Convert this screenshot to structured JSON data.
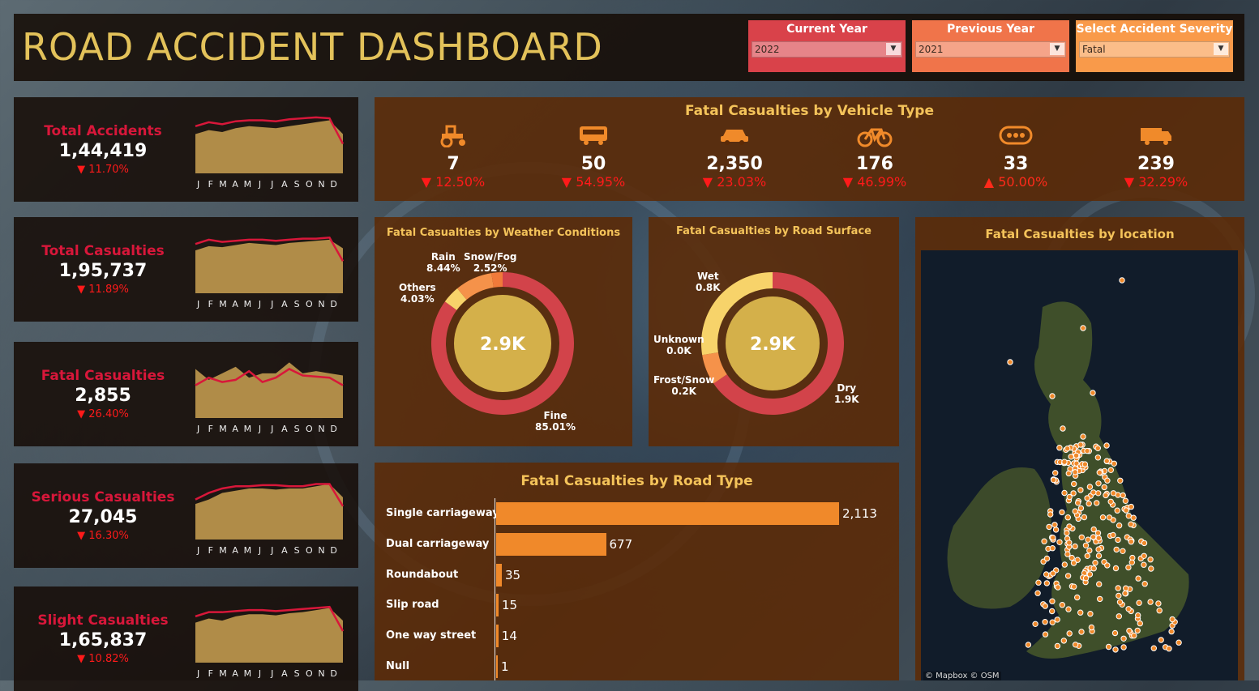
{
  "header": {
    "title": "ROAD ACCIDENT DASHBOARD",
    "filters": [
      {
        "label": "Current Year",
        "value": "2022",
        "color": "#d9424a"
      },
      {
        "label": "Previous Year",
        "value": "2021",
        "color": "#f0744a"
      },
      {
        "label": "Select Accident Severity",
        "value": "Fatal",
        "color": "#f99a4a"
      }
    ]
  },
  "months": [
    "J",
    "F",
    "M",
    "A",
    "M",
    "J",
    "J",
    "A",
    "S",
    "O",
    "N",
    "D"
  ],
  "kpis": [
    {
      "title": "Total Accidents",
      "value": "1,44,419",
      "delta": "▼ 11.70%",
      "current": [
        78,
        82,
        80,
        83,
        84,
        84,
        83,
        85,
        86,
        87,
        86,
        60
      ],
      "previous": [
        70,
        74,
        72,
        76,
        78,
        77,
        76,
        78,
        80,
        82,
        84,
        70
      ]
    },
    {
      "title": "Total Casualties",
      "value": "1,95,737",
      "delta": "▼ 11.89%",
      "current": [
        78,
        82,
        80,
        81,
        82,
        82,
        81,
        82,
        83,
        83,
        84,
        62
      ],
      "previous": [
        72,
        76,
        75,
        77,
        79,
        78,
        77,
        79,
        80,
        81,
        82,
        74
      ]
    },
    {
      "title": "Fatal Casualties",
      "value": "2,855",
      "delta": "▼ 26.40%",
      "current": [
        55,
        62,
        58,
        60,
        68,
        58,
        62,
        70,
        64,
        63,
        62,
        55
      ],
      "previous": [
        70,
        60,
        66,
        72,
        62,
        66,
        66,
        76,
        66,
        68,
        66,
        64
      ]
    },
    {
      "title": "Serious Casualties",
      "value": "27,045",
      "delta": "▼ 16.30%",
      "current": [
        70,
        76,
        80,
        82,
        82,
        83,
        83,
        82,
        82,
        84,
        84,
        64
      ],
      "previous": [
        66,
        70,
        76,
        78,
        80,
        80,
        79,
        80,
        80,
        82,
        84,
        72
      ]
    },
    {
      "title": "Slight Casualties",
      "value": "1,65,837",
      "delta": "▼ 10.82%",
      "current": [
        76,
        80,
        80,
        81,
        82,
        82,
        81,
        82,
        83,
        84,
        85,
        62
      ],
      "previous": [
        70,
        74,
        72,
        76,
        78,
        78,
        77,
        79,
        80,
        82,
        84,
        72
      ]
    }
  ],
  "vehicle": {
    "title": "Fatal Casualties by Vehicle Type",
    "items": [
      {
        "icon": "tractor-icon",
        "value": "7",
        "delta": "▼ 12.50%",
        "up": false
      },
      {
        "icon": "bus-icon",
        "value": "50",
        "delta": "▼ 54.95%",
        "up": false
      },
      {
        "icon": "car-icon",
        "value": "2,350",
        "delta": "▼ 23.03%",
        "up": false
      },
      {
        "icon": "bicycle-icon",
        "value": "176",
        "delta": "▼ 46.99%",
        "up": false
      },
      {
        "icon": "other-icon",
        "value": "33",
        "delta": "▲ 50.00%",
        "up": true
      },
      {
        "icon": "van-icon",
        "value": "239",
        "delta": "▼ 32.29%",
        "up": false
      }
    ]
  },
  "weather": {
    "title": "Fatal Casualties by Weather Conditions",
    "center": "2.9K",
    "labels": [
      {
        "name": "Rain",
        "value": "8.44%"
      },
      {
        "name": "Snow/Fog",
        "value": "2.52%"
      },
      {
        "name": "Others",
        "value": "4.03%"
      },
      {
        "name": "Fine",
        "value": "85.01%"
      }
    ]
  },
  "surface": {
    "title": "Fatal Casualties by Road Surface",
    "center": "2.9K",
    "labels": [
      {
        "name": "Wet",
        "value": "0.8K"
      },
      {
        "name": "Unknown",
        "value": "0.0K"
      },
      {
        "name": "Frost/Snow",
        "value": "0.2K"
      },
      {
        "name": "Dry",
        "value": "1.9K"
      }
    ]
  },
  "chart_data": [
    {
      "type": "pie",
      "title": "Fatal Casualties by Weather Conditions",
      "categories": [
        "Fine",
        "Others",
        "Rain",
        "Snow/Fog"
      ],
      "values": [
        85.01,
        4.03,
        8.44,
        2.52
      ],
      "center_label": "2.9K",
      "colors": [
        "#d2434a",
        "#f7d36a",
        "#f5924a",
        "#f07a3a"
      ]
    },
    {
      "type": "pie",
      "title": "Fatal Casualties by Road Surface",
      "categories": [
        "Dry",
        "Frost/Snow",
        "Unknown",
        "Wet"
      ],
      "values": [
        1.9,
        0.2,
        0.0,
        0.8
      ],
      "center_label": "2.9K",
      "colors": [
        "#d2434a",
        "#f5924a",
        "#c5a040",
        "#f7d36a"
      ]
    },
    {
      "type": "bar",
      "title": "Fatal Casualties by Road Type",
      "categories": [
        "Single carriageway",
        "Dual carriageway",
        "Roundabout",
        "Slip road",
        "One way street",
        "Null"
      ],
      "values": [
        2113,
        677,
        35,
        15,
        14,
        1
      ],
      "value_labels": [
        "2,113",
        "677",
        "35",
        "15",
        "14",
        "1"
      ]
    }
  ],
  "road_type": {
    "title": "Fatal Casualties by Road Type"
  },
  "map": {
    "title": "Fatal Casualties by location",
    "attribution": "© Mapbox © OSM"
  }
}
